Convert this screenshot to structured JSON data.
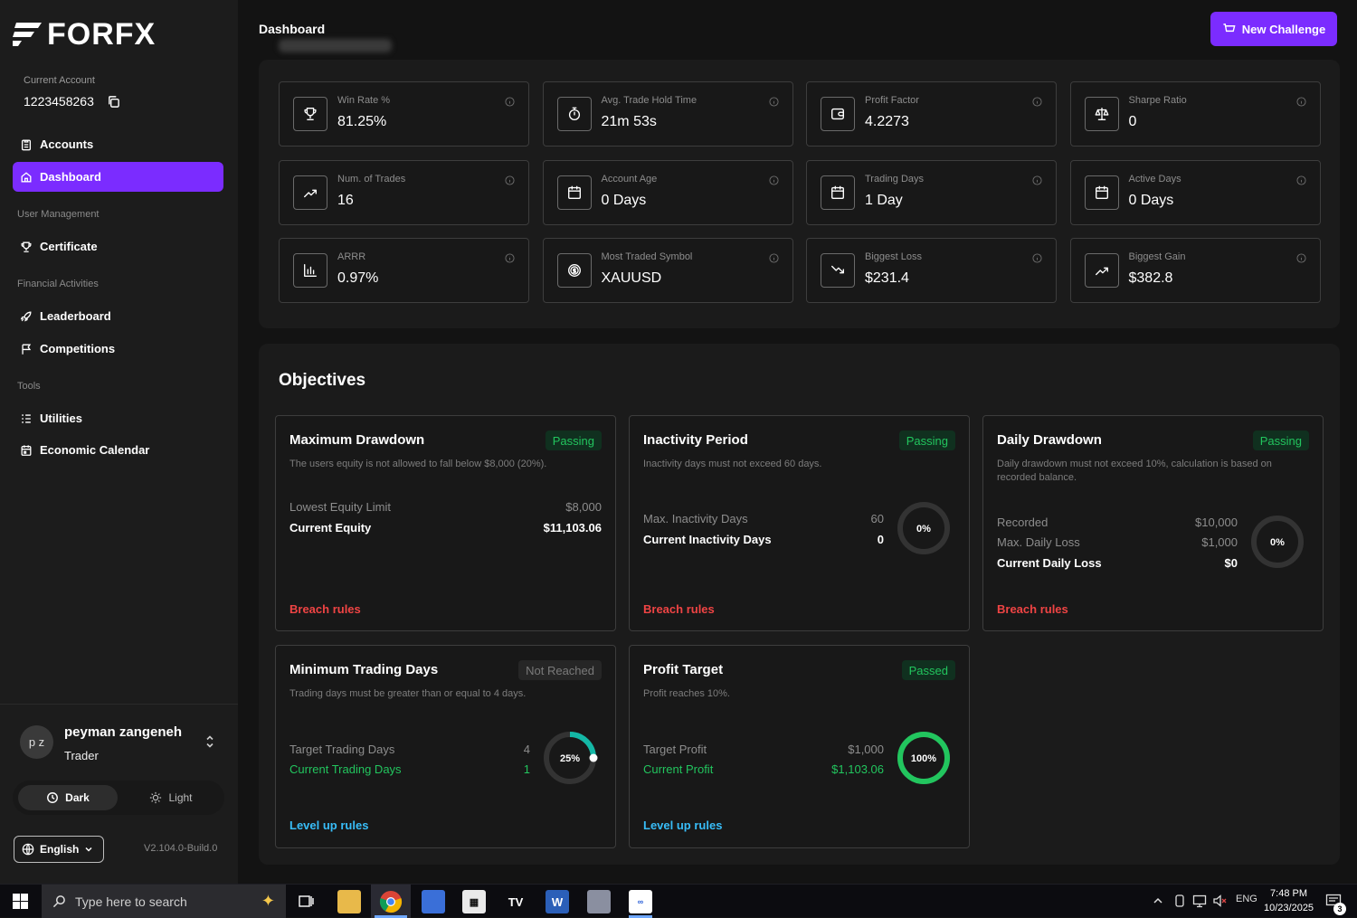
{
  "brand": {
    "name": "FORFX"
  },
  "sidebar": {
    "current_account_label": "Current Account",
    "account_number": "1223458263",
    "items": [
      {
        "label": "Accounts",
        "icon": "clipboard-icon"
      },
      {
        "label": "Dashboard",
        "icon": "home-icon",
        "active": true
      }
    ],
    "sections": [
      {
        "title": "User Management",
        "items": [
          {
            "label": "Certificate",
            "icon": "trophy-icon"
          }
        ]
      },
      {
        "title": "Financial Activities",
        "items": [
          {
            "label": "Leaderboard",
            "icon": "rocket-icon"
          },
          {
            "label": "Competitions",
            "icon": "flag-icon"
          }
        ]
      },
      {
        "title": "Tools",
        "items": [
          {
            "label": "Utilities",
            "icon": "list-icon"
          },
          {
            "label": "Economic Calendar",
            "icon": "calendar-icon"
          }
        ]
      }
    ],
    "user": {
      "initials": "p z",
      "name": "peyman zangeneh",
      "role": "Trader"
    },
    "theme": {
      "dark_label": "Dark",
      "light_label": "Light",
      "selected": "Dark"
    },
    "language": "English",
    "version": "V2.104.0-Build.0"
  },
  "header": {
    "title": "Dashboard",
    "new_challenge_label": "New Challenge"
  },
  "stats": [
    {
      "label": "Win Rate %",
      "value": "81.25%",
      "icon": "trophy-icon"
    },
    {
      "label": "Avg. Trade Hold Time",
      "value": "21m 53s",
      "icon": "stopwatch-icon"
    },
    {
      "label": "Profit Factor",
      "value": "4.2273",
      "icon": "wallet-icon"
    },
    {
      "label": "Sharpe Ratio",
      "value": "0",
      "icon": "scale-icon"
    },
    {
      "label": "Num. of Trades",
      "value": "16",
      "icon": "trend-up-icon"
    },
    {
      "label": "Account Age",
      "value": "0 Days",
      "icon": "calendar-icon"
    },
    {
      "label": "Trading Days",
      "value": "1 Day",
      "icon": "calendar-icon"
    },
    {
      "label": "Active Days",
      "value": "0 Days",
      "icon": "calendar-icon"
    },
    {
      "label": "ARRR",
      "value": "0.97%",
      "icon": "bar-chart-icon"
    },
    {
      "label": "Most Traded Symbol",
      "value": "XAUUSD",
      "icon": "coin-icon"
    },
    {
      "label": "Biggest Loss",
      "value": "$231.4",
      "icon": "trend-down-icon"
    },
    {
      "label": "Biggest Gain",
      "value": "$382.8",
      "icon": "trend-up-icon"
    }
  ],
  "objectives": {
    "title": "Objectives",
    "max_drawdown": {
      "name": "Maximum Drawdown",
      "status": "Passing",
      "desc": "The users equity is not allowed to fall below $8,000 (20%).",
      "rows": [
        {
          "k": "Lowest Equity Limit",
          "v": "$8,000"
        },
        {
          "k": "Current Equity",
          "v": "$11,103.06"
        }
      ],
      "link": "Breach rules"
    },
    "inactivity": {
      "name": "Inactivity Period",
      "status": "Passing",
      "desc": "Inactivity days must not exceed 60 days.",
      "rows": [
        {
          "k": "Max. Inactivity Days",
          "v": "60"
        },
        {
          "k": "Current Inactivity Days",
          "v": "0"
        }
      ],
      "progress": 0,
      "progress_label": "0%",
      "link": "Breach rules"
    },
    "daily_drawdown": {
      "name": "Daily Drawdown",
      "status": "Passing",
      "desc": "Daily drawdown must not exceed 10%, calculation is based on recorded balance.",
      "rows": [
        {
          "k": "Recorded",
          "v": "$10,000"
        },
        {
          "k": "Max. Daily Loss",
          "v": "$1,000"
        },
        {
          "k": "Current Daily Loss",
          "v": "$0"
        }
      ],
      "progress": 0,
      "progress_label": "0%",
      "link": "Breach rules"
    },
    "min_trading_days": {
      "name": "Minimum Trading Days",
      "status": "Not Reached",
      "desc": "Trading days must be greater than or equal to 4 days.",
      "rows": [
        {
          "k": "Target Trading Days",
          "v": "4"
        },
        {
          "k": "Current Trading Days",
          "v": "1"
        }
      ],
      "progress": 25,
      "progress_label": "25%",
      "link": "Level up rules"
    },
    "profit_target": {
      "name": "Profit Target",
      "status": "Passed",
      "desc": "Profit reaches 10%.",
      "rows": [
        {
          "k": "Target Profit",
          "v": "$1,000"
        },
        {
          "k": "Current Profit",
          "v": "$1,103.06"
        }
      ],
      "progress": 100,
      "progress_label": "100%",
      "link": "Level up rules"
    }
  },
  "colors": {
    "accent": "#7b2cff",
    "pass": "#22c55e",
    "danger": "#ef4444",
    "link": "#38bdf8",
    "ring_track": "#333333"
  },
  "taskbar": {
    "search_placeholder": "Type here to search",
    "language": "ENG",
    "time": "7:48 PM",
    "date": "10/23/2025",
    "notification_count": "3"
  }
}
